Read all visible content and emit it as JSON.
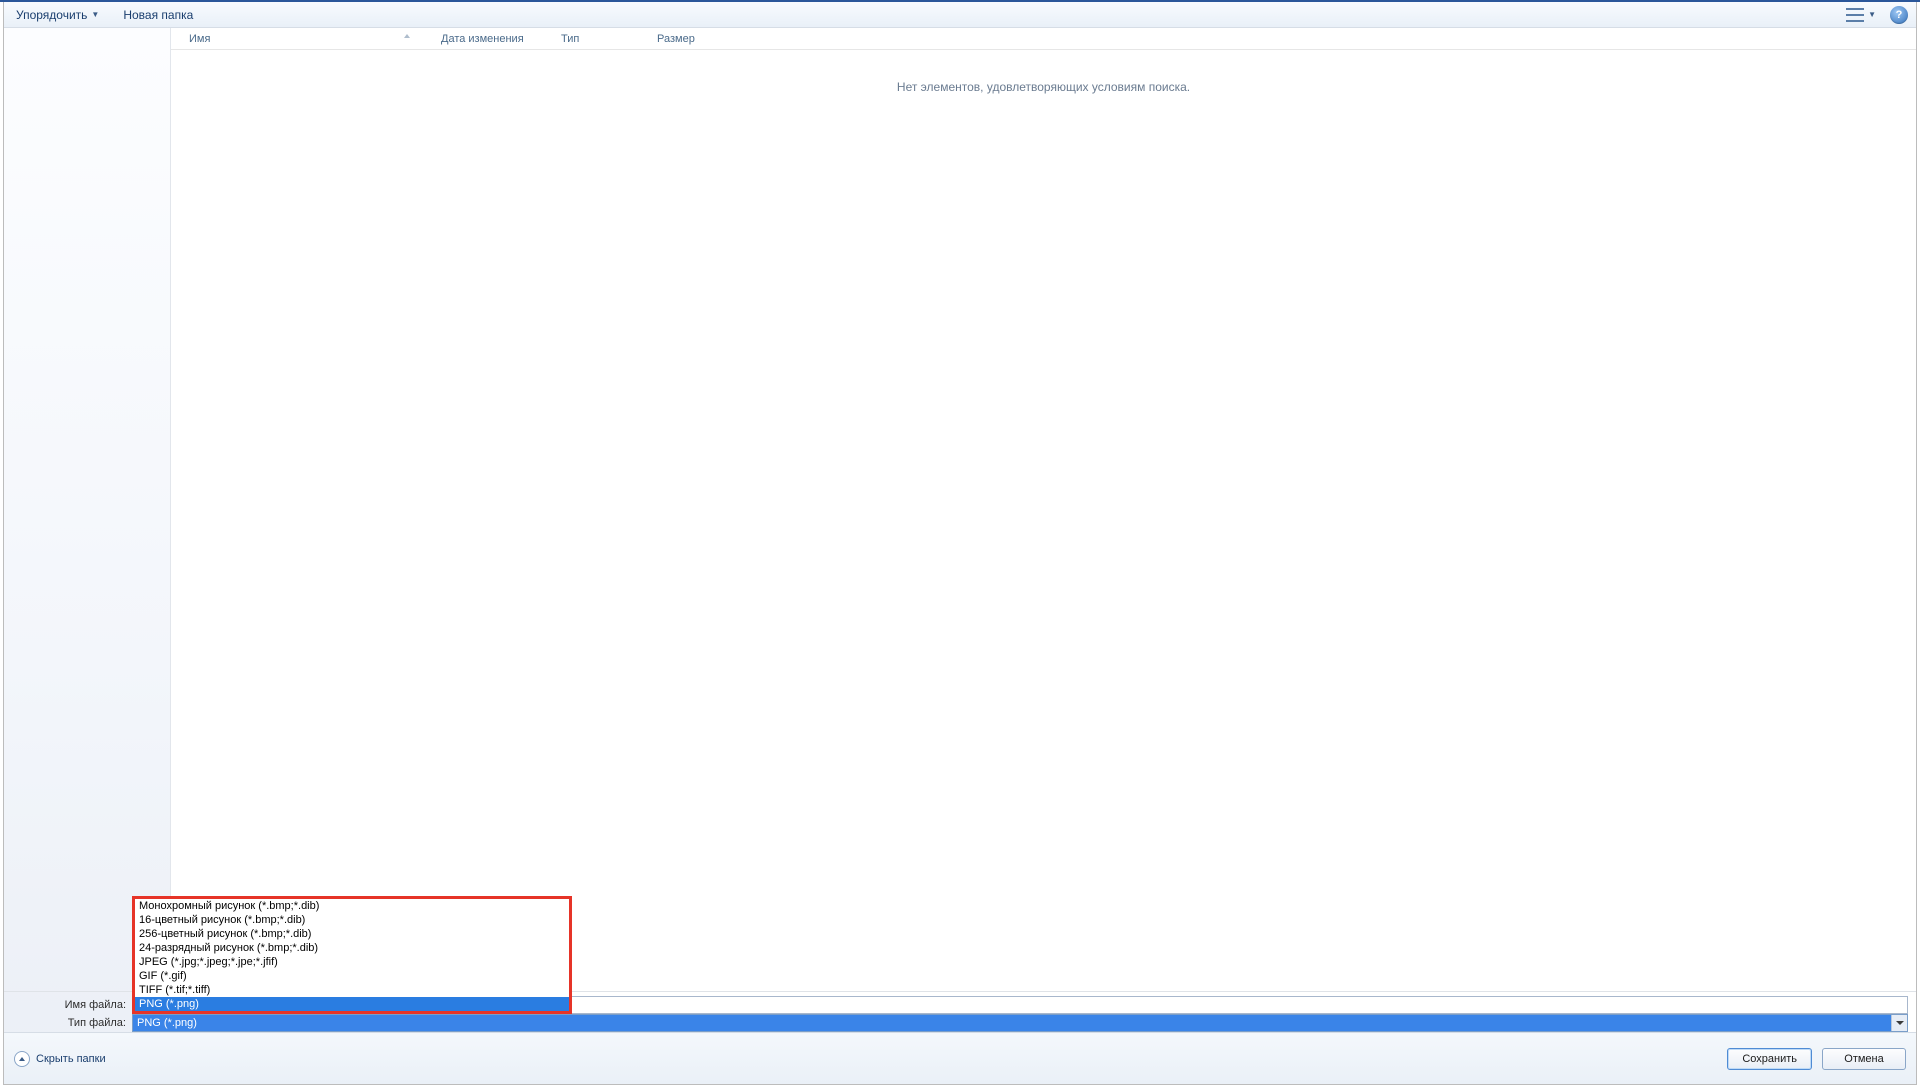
{
  "toolbar": {
    "organize": "Упорядочить",
    "new_folder": "Новая папка",
    "help_glyph": "?"
  },
  "columns": {
    "name": "Имя",
    "date": "Дата изменения",
    "type": "Тип",
    "size": "Размер"
  },
  "content": {
    "empty": "Нет элементов, удовлетворяющих условиям поиска."
  },
  "fields": {
    "filename_label": "Имя файла:",
    "filetype_label": "Тип файла:",
    "filetype_value": "PNG (*.png)"
  },
  "type_options": [
    "Монохромный рисунок (*.bmp;*.dib)",
    "16-цветный рисунок (*.bmp;*.dib)",
    "256-цветный рисунок (*.bmp;*.dib)",
    "24-разрядный рисунок (*.bmp;*.dib)",
    "JPEG (*.jpg;*.jpeg;*.jpe;*.jfif)",
    "GIF (*.gif)",
    "TIFF (*.tif;*.tiff)",
    "PNG (*.png)"
  ],
  "type_selected_index": 7,
  "footer": {
    "hide_folders": "Скрыть папки",
    "save": "Сохранить",
    "cancel": "Отмена"
  }
}
